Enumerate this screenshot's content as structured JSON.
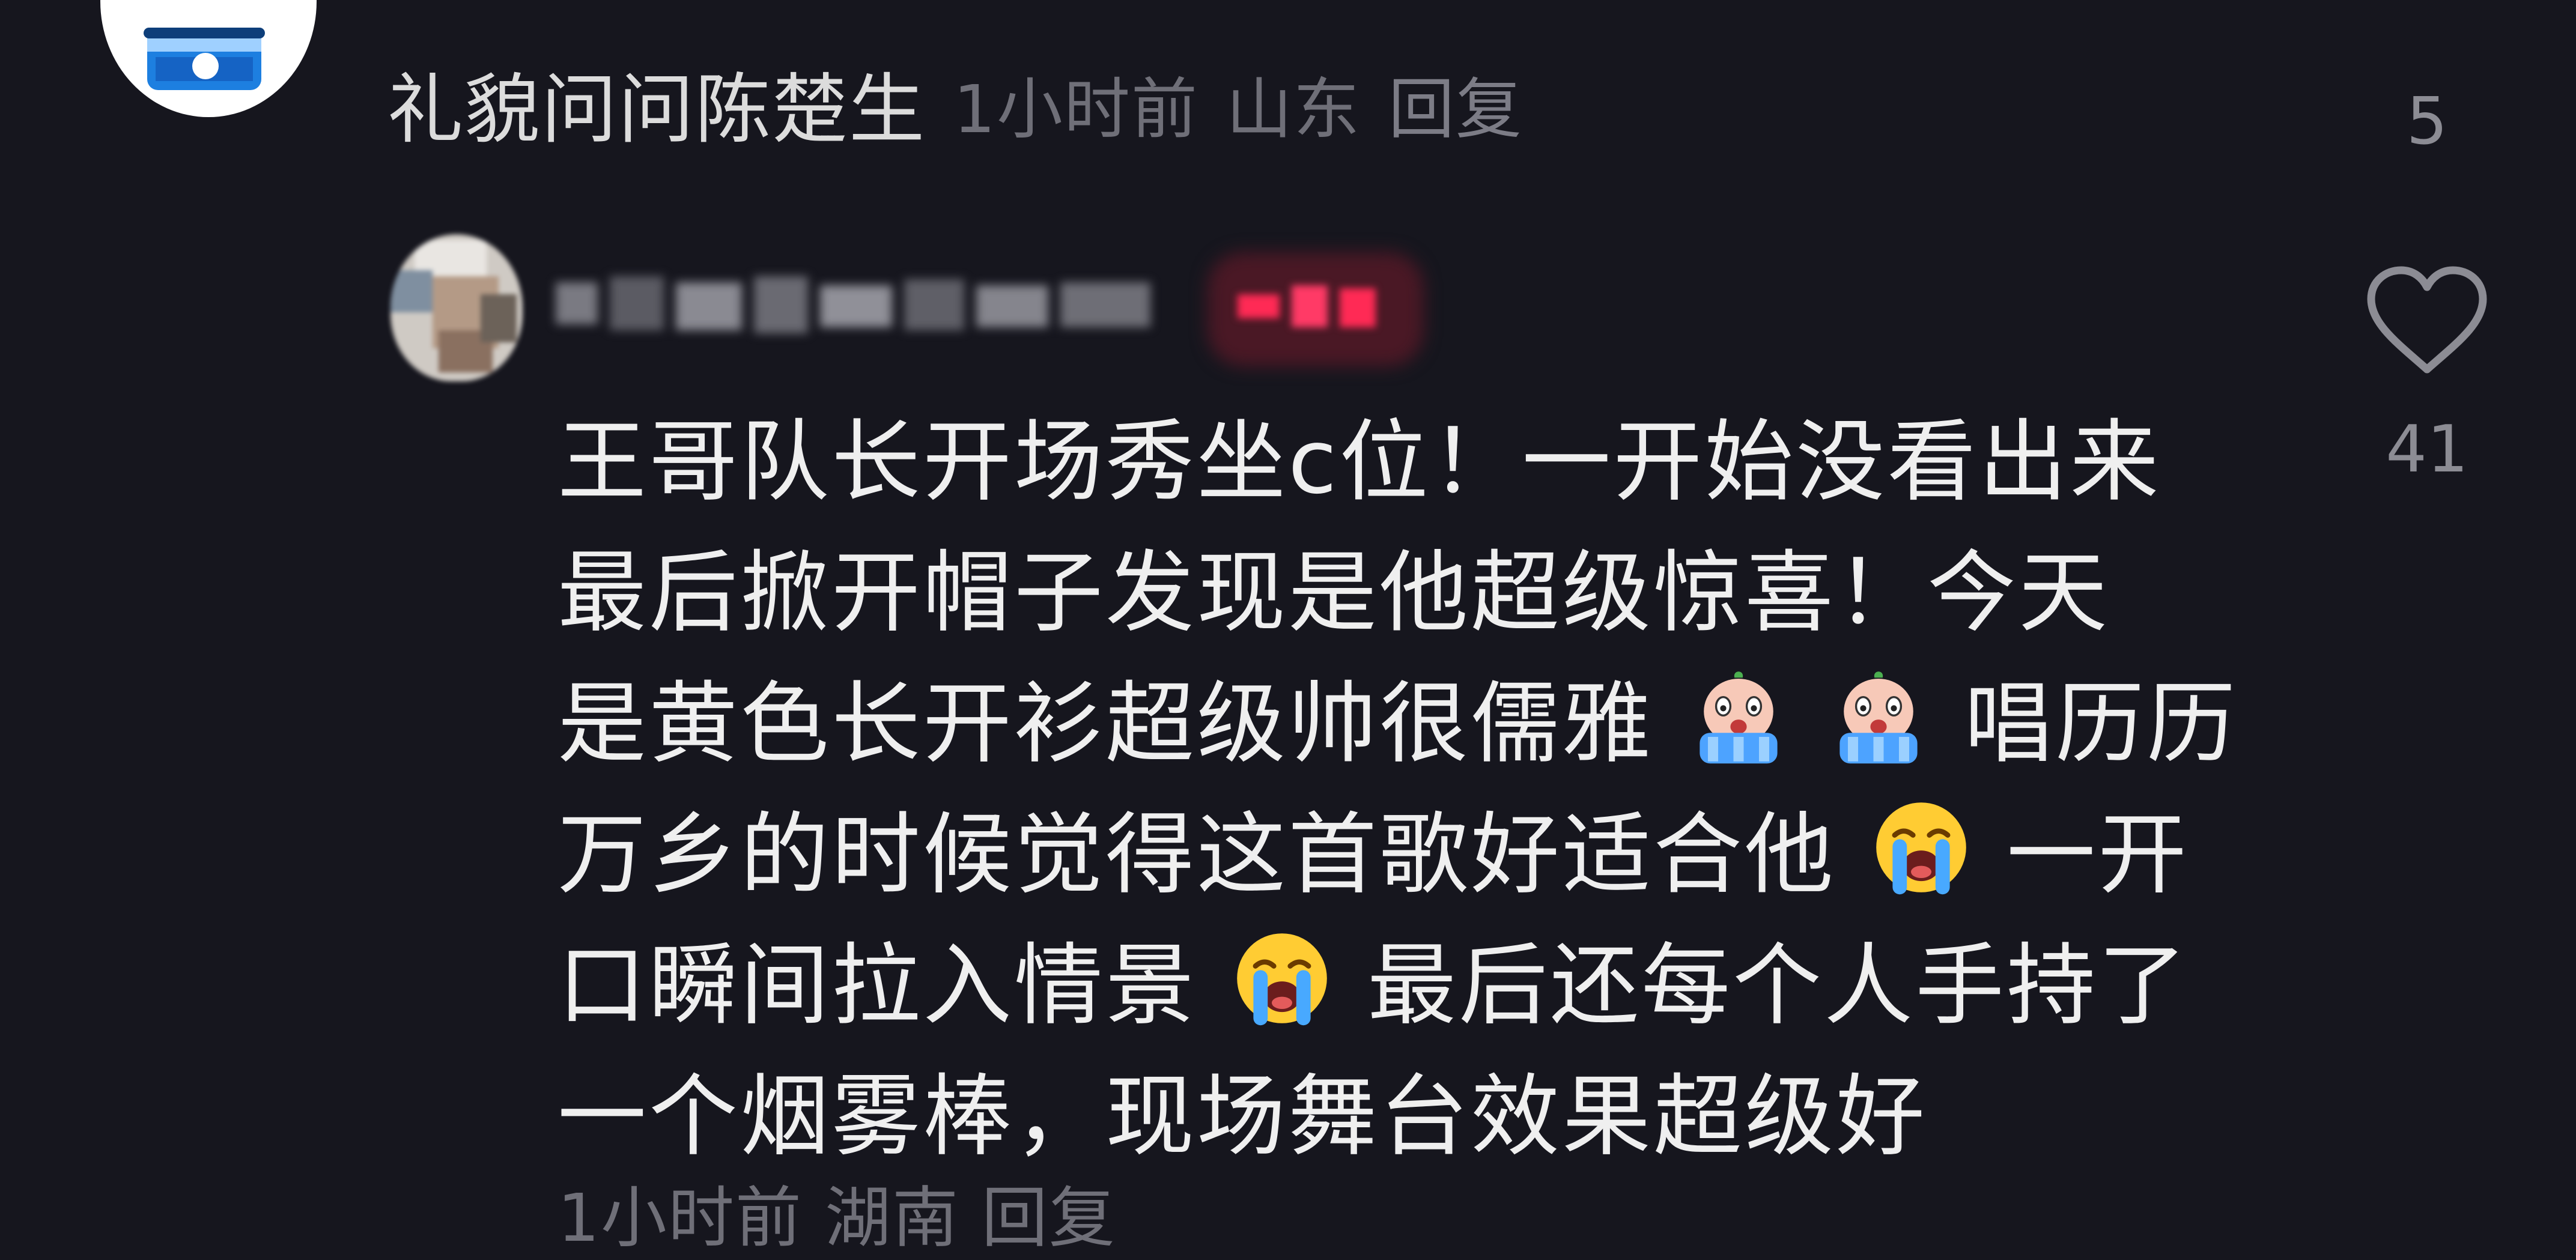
{
  "top_comment": {
    "username": "礼貌问问陈楚生",
    "time": "1小时前",
    "location": "山东",
    "reply_label": "回复",
    "like_count": "5"
  },
  "reply_comment": {
    "body_lines": [
      "王哥队长开场秀坐c位！一开始没看出来",
      "最后掀开帽子发现是他超级惊喜！今天",
      [
        "是黄色长开衫超级帅很儒雅",
        "crying-baby",
        "crying-baby",
        "唱历历"
      ],
      [
        "万乡的时候觉得这首歌好适合他",
        "loudly-crying",
        "一开"
      ],
      [
        "口瞬间拉入情景",
        "loudly-crying",
        "最后还每个人手持了"
      ],
      "一个烟雾棒，现场舞台效果超级好"
    ],
    "like_count": "41",
    "meta_partial": "1小时前 湖南 回复"
  },
  "colors": {
    "background": "#16161e",
    "text_primary": "#efefef",
    "text_secondary": "#6f6f78",
    "icon": "#8c8c94"
  }
}
